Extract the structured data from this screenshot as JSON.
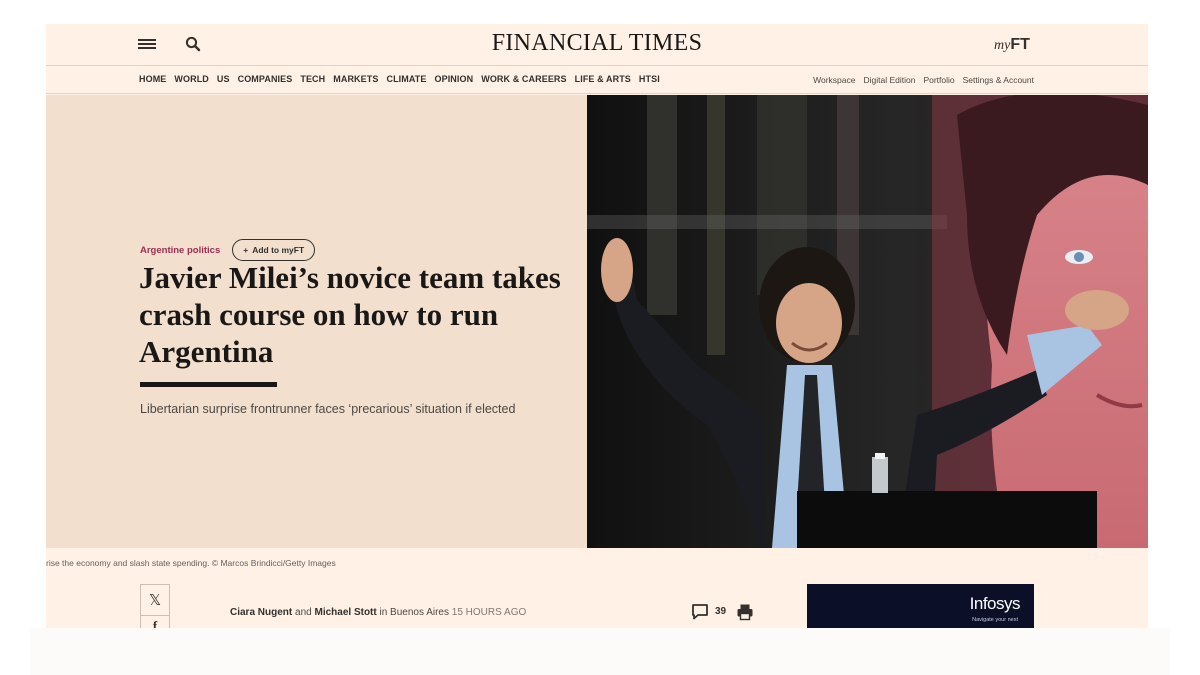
{
  "header": {
    "masthead": "FINANCIAL TIMES",
    "myft_my": "my",
    "myft_ft": "FT",
    "menu_icon": "hamburger-menu-icon",
    "search_icon": "search-icon"
  },
  "nav": {
    "left": [
      "HOME",
      "WORLD",
      "US",
      "COMPANIES",
      "TECH",
      "MARKETS",
      "CLIMATE",
      "OPINION",
      "WORK & CAREERS",
      "LIFE & ARTS",
      "HTSI"
    ],
    "right": [
      "Workspace",
      "Digital Edition",
      "Portfolio",
      "Settings & Account"
    ]
  },
  "article": {
    "topic": "Argentine politics",
    "add_button": "Add to myFT",
    "headline": "Javier Milei’s novice team takes crash course on how to run Argentina",
    "standfirst": "Libertarian surprise frontrunner faces ‘precarious’ situation if elected",
    "caption": "rise the economy and slash state spending. © Marcos Brindicci/Getty Images",
    "byline": {
      "author1": "Ciara Nugent",
      "and": "and",
      "author2": "Michael Stott",
      "location": "in Buenos Aires",
      "time": "15 HOURS AGO"
    },
    "comments_count": "39"
  },
  "share": {
    "x_label": "𝕏",
    "facebook_label": "f"
  },
  "ad": {
    "brand": "Infosys",
    "slogan": "Navigate your next"
  },
  "colors": {
    "page_background": "#fff1e5",
    "hero_panel": "#f2dfce",
    "topic_accent": "#9e2f50",
    "ad_background": "#0b0f28"
  }
}
